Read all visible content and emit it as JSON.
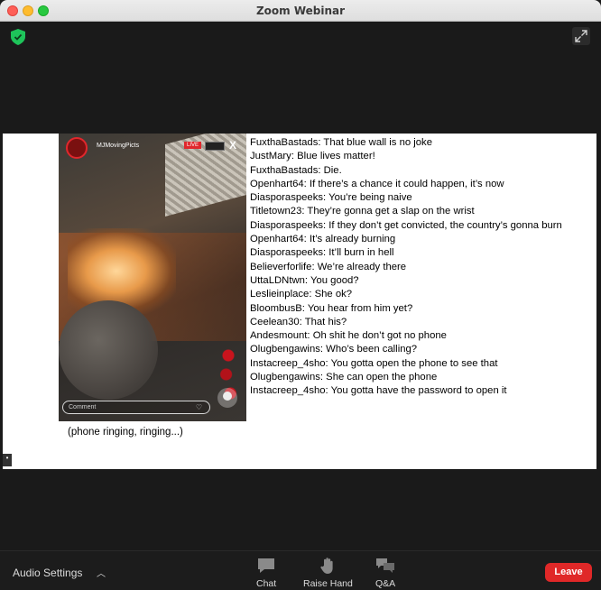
{
  "window": {
    "title": "Zoom Webinar"
  },
  "video": {
    "username": "MJMovingPicts",
    "live_badge": "LIVE",
    "close_label": "X",
    "comment_placeholder": "Comment"
  },
  "chat_lines": [
    "FuxthaBastads: That blue wall is no joke",
    "JustMary: Blue lives matter!",
    "FuxthaBastads: Die.",
    "Openhart64: If there’s a chance it could happen, it’s now",
    "Diasporaspeeks: You’re being naive",
    "Titletown23: They’re gonna get a slap on the wrist",
    "Diasporaspeeks: If they don’t get convicted, the country’s gonna burn",
    "Openhart64: It’s already burning",
    "Diasporaspeeks: It’ll burn in hell",
    "Believerforlife: We’re already there",
    "UttaLDNtwn: You good?",
    "Leslieinplace: She ok?",
    "BloombusB: You hear from him yet?",
    "Ceelean30: That his?",
    "Andesmount: Oh shit he don’t got no phone",
    "Olugbengawins: Who’s been calling?",
    "Instacreep_4sho: You gotta open the phone to see that",
    "Olugbengawins: She can open the phone",
    "Instacreep_4sho: You gotta have the password to open it"
  ],
  "caption": "(phone ringing, ringing...)",
  "toolbar": {
    "audio_settings": "Audio Settings",
    "chat": "Chat",
    "raise_hand": "Raise Hand",
    "qa": "Q&A",
    "leave": "Leave"
  },
  "colors": {
    "leave_button": "#e02828",
    "security_shield": "#1ec45a"
  }
}
